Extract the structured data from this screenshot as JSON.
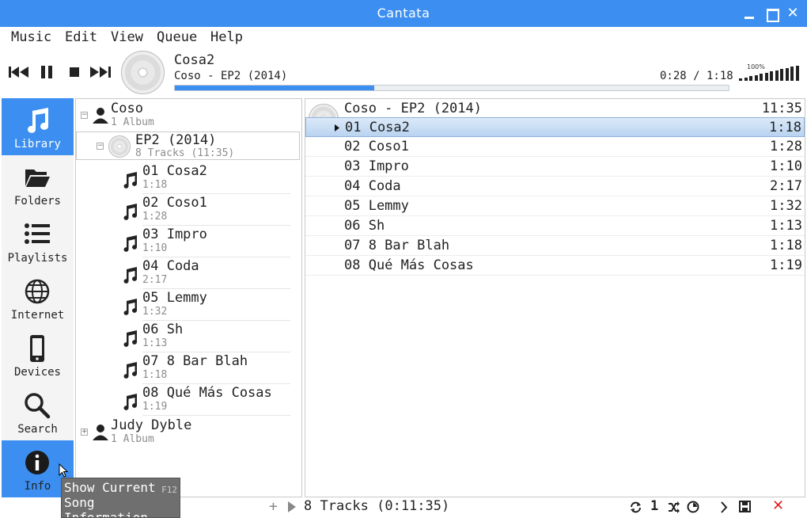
{
  "window": {
    "title": "Cantata"
  },
  "menu": [
    "Music",
    "Edit",
    "View",
    "Queue",
    "Help"
  ],
  "now_playing": {
    "title": "Cosa2",
    "subtitle": "Coso - EP2 (2014)",
    "time": "0:28 / 1:18",
    "progress": 0.36,
    "volume_label": "100%",
    "volume_level": 1.0
  },
  "sidebar": {
    "items": [
      {
        "label": "Library",
        "icon": "music-note-icon",
        "active": true
      },
      {
        "label": "Folders",
        "icon": "folder-icon",
        "active": false
      },
      {
        "label": "Playlists",
        "icon": "list-icon",
        "active": false
      },
      {
        "label": "Internet",
        "icon": "globe-icon",
        "active": false
      },
      {
        "label": "Devices",
        "icon": "phone-icon",
        "active": false
      },
      {
        "label": "Search",
        "icon": "search-icon",
        "active": false
      },
      {
        "label": "Info",
        "icon": "info-icon",
        "active": true
      }
    ]
  },
  "library": {
    "artists": [
      {
        "name": "Coso",
        "sub": "1 Album",
        "expanded": true
      },
      {
        "name": "Judy Dyble",
        "sub": "1 Album",
        "expanded": false
      }
    ],
    "album": {
      "name": "EP2 (2014)",
      "sub": "8 Tracks (11:35)"
    },
    "tracks": [
      {
        "name": "01 Cosa2",
        "dur": "1:18"
      },
      {
        "name": "02 Coso1",
        "dur": "1:28"
      },
      {
        "name": "03 Impro",
        "dur": "1:10"
      },
      {
        "name": "04 Coda",
        "dur": "2:17"
      },
      {
        "name": "05 Lemmy",
        "dur": "1:32"
      },
      {
        "name": "06 Sh",
        "dur": "1:13"
      },
      {
        "name": "07 8 Bar Blah",
        "dur": "1:18"
      },
      {
        "name": "08 Qué Más Cosas",
        "dur": "1:19"
      }
    ]
  },
  "queue": {
    "header": "Coso - EP2 (2014)",
    "header_dur": "11:35",
    "rows": [
      {
        "name": "01 Cosa2",
        "dur": "1:18"
      },
      {
        "name": "02 Coso1",
        "dur": "1:28"
      },
      {
        "name": "03 Impro",
        "dur": "1:10"
      },
      {
        "name": "04 Coda",
        "dur": "2:17"
      },
      {
        "name": "05 Lemmy",
        "dur": "1:32"
      },
      {
        "name": "06 Sh",
        "dur": "1:13"
      },
      {
        "name": "07 8 Bar Blah",
        "dur": "1:18"
      },
      {
        "name": "08 Qué Más Cosas",
        "dur": "1:19"
      }
    ]
  },
  "status": {
    "summary": "8 Tracks (0:11:35)",
    "single_label": "1"
  },
  "tooltip": {
    "text": "Show Current Song Information",
    "shortcut": "F12"
  },
  "colors": {
    "accent": "#3c8ff0",
    "stop": "#e02020"
  }
}
